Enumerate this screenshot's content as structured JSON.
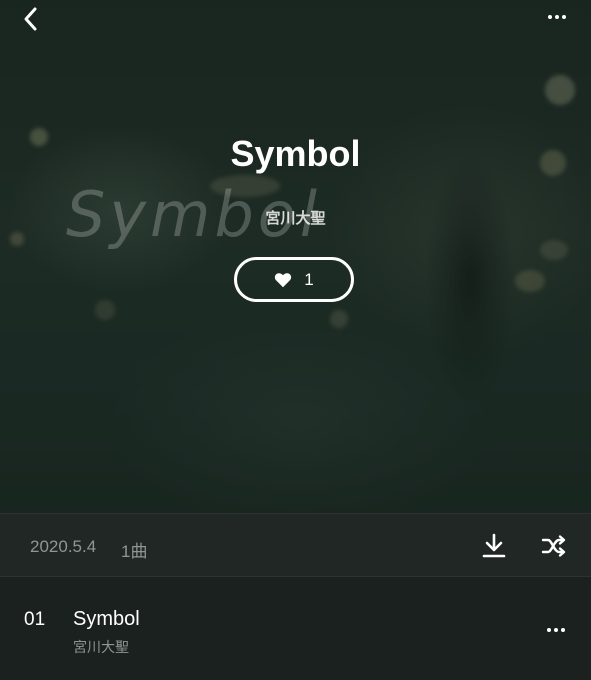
{
  "header": {
    "back_icon": "chevron-left-icon",
    "more_icon": "more-horizontal-icon"
  },
  "album": {
    "title": "Symbol",
    "cover_watermark": "Symbol",
    "artist": "宮川大聖",
    "like_icon": "heart-icon",
    "like_count": "1"
  },
  "info_bar": {
    "release_date": "2020.5.4",
    "track_count": "1曲",
    "download_icon": "download-icon",
    "shuffle_icon": "shuffle-icon"
  },
  "tracks": [
    {
      "number": "01",
      "title": "Symbol",
      "artist": "宮川大聖",
      "more_icon": "more-horizontal-icon"
    }
  ],
  "colors": {
    "background": "#1b211e",
    "info_bar_bg": "#202724",
    "secondary_text": "#8f9693",
    "primary_text": "#ffffff"
  }
}
